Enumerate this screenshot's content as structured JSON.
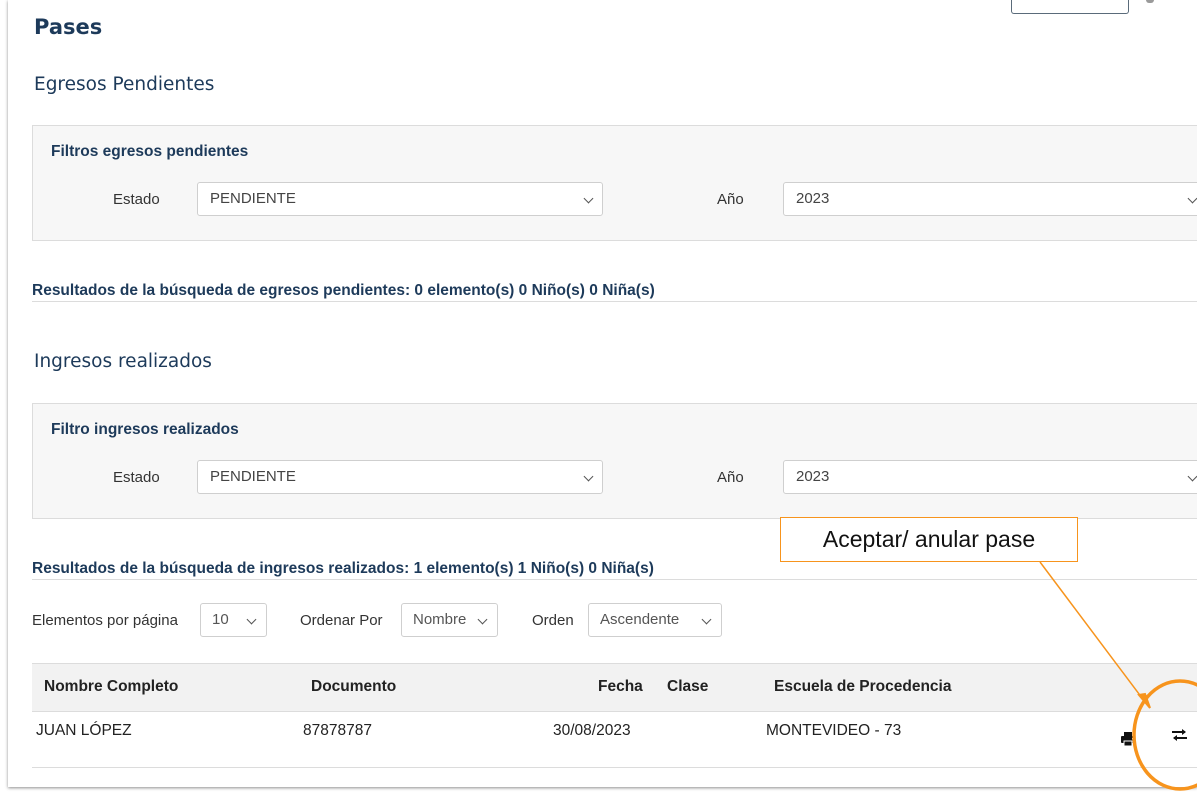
{
  "page": {
    "title": "Pases"
  },
  "egresos": {
    "heading": "Egresos Pendientes",
    "filter_title": "Filtros egresos pendientes",
    "estado_label": "Estado",
    "estado_value": "PENDIENTE",
    "anio_label": "Año",
    "anio_value": "2023",
    "results": "Resultados de la búsqueda de egresos pendientes: 0 elemento(s) 0 Niño(s) 0 Niña(s)"
  },
  "ingresos": {
    "heading": "Ingresos realizados",
    "filter_title": "Filtro ingresos realizados",
    "estado_label": "Estado",
    "estado_value": "PENDIENTE",
    "anio_label": "Año",
    "anio_value": "2023",
    "results": "Resultados de la búsqueda de ingresos realizados: 1 elemento(s) 1 Niño(s) 0 Niña(s)",
    "controls": {
      "per_page_label": "Elementos por página",
      "per_page_value": "10",
      "order_by_label": "Ordenar Por",
      "order_by_value": "Nombre",
      "order_label": "Orden",
      "order_value": "Ascendente"
    },
    "table": {
      "columns": [
        "Nombre Completo",
        "Documento",
        "Fecha",
        "Clase",
        "Escuela de Procedencia"
      ],
      "rows": [
        {
          "nombre": "JUAN LÓPEZ",
          "documento": "87878787",
          "fecha": "30/08/2023",
          "clase": "",
          "escuela": "MONTEVIDEO - 73"
        }
      ],
      "row_actions": [
        "print-icon",
        "transfer-icon"
      ]
    }
  },
  "annotation": {
    "callout_text": "Aceptar/ anular pase",
    "color": "#f7941d"
  },
  "colors": {
    "heading": "#1d3a5a",
    "filter_bg": "#f7f7f7",
    "table_head_bg": "#f2f2f2"
  }
}
